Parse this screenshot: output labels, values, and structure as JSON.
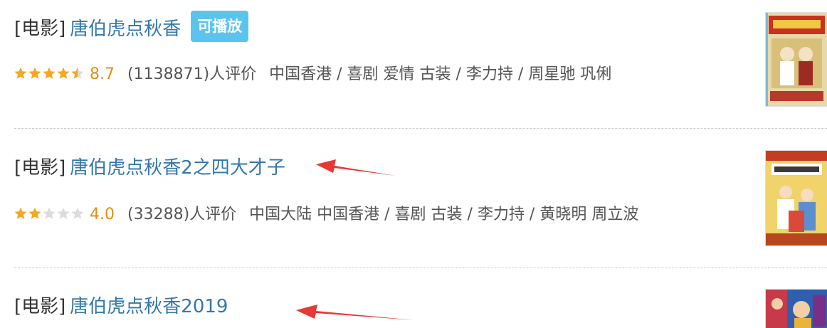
{
  "results": [
    {
      "category": "[电影]",
      "title": "唐伯虎点秋香",
      "badge": "可播放",
      "rating": 8.7,
      "score_text": "8.7",
      "stars_filled": 4.5,
      "votes": "(1138871)人评价",
      "meta": "中国香港 / 喜剧 爱情 古装 / 李力持 / 周星驰 巩俐",
      "poster_icon": "movie-poster"
    },
    {
      "category": "[电影]",
      "title": "唐伯虎点秋香2之四大才子",
      "rating": 4.0,
      "score_text": "4.0",
      "stars_filled": 2,
      "votes": "(33288)人评价",
      "meta": "中国大陆 中国香港 / 喜剧 古装 / 李力持 / 黄晓明 周立波",
      "poster_icon": "movie-poster"
    },
    {
      "category": "[电影]",
      "title": "唐伯虎点秋香2019",
      "poster_icon": "movie-poster"
    }
  ],
  "colors": {
    "link": "#3377aa",
    "score": "#e09015",
    "star_filled": "#f5a623",
    "star_empty": "#dcdcdc",
    "badge_bg": "#5bc4ee",
    "arrow": "#e53935"
  },
  "annotations": [
    "red-arrow",
    "red-arrow"
  ]
}
